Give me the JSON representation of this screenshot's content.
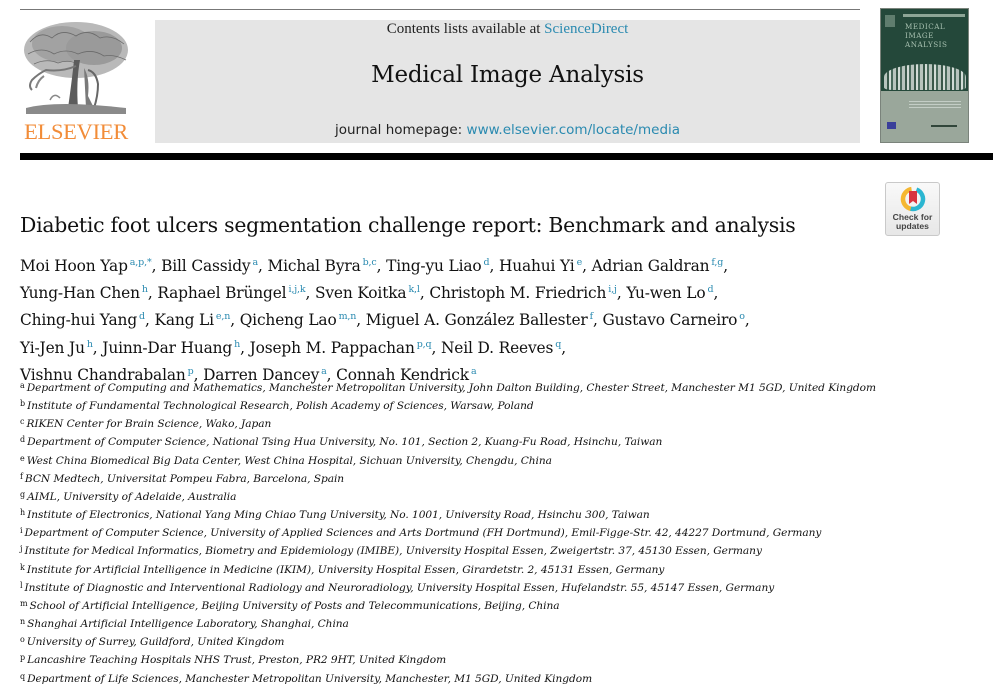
{
  "header": {
    "contents_prefix": "Contents lists available at ",
    "contents_link": "ScienceDirect",
    "journal_title": "Medical Image Analysis",
    "homepage_prefix": "journal homepage: ",
    "homepage_link": "www.elsevier.com/locate/media",
    "publisher": "ELSEVIER",
    "cover_title_lines": [
      "MEDICAL",
      "IMAGE",
      "ANALYSIS"
    ]
  },
  "check_updates": {
    "line1": "Check for",
    "line2": "updates"
  },
  "article": {
    "title": "Diabetic foot ulcers segmentation challenge report: Benchmark and analysis"
  },
  "authors": {
    "lines": [
      [
        {
          "name": "Moi Hoon Yap",
          "refs": "a,p,*",
          "sep": ", "
        },
        {
          "name": "Bill Cassidy",
          "refs": "a",
          "sep": ", "
        },
        {
          "name": "Michal Byra",
          "refs": "b,c",
          "sep": ", "
        },
        {
          "name": "Ting-yu Liao",
          "refs": "d",
          "sep": ", "
        },
        {
          "name": "Huahui Yi",
          "refs": "e",
          "sep": ", "
        },
        {
          "name": "Adrian Galdran",
          "refs": "f,g",
          "sep": ","
        }
      ],
      [
        {
          "name": "Yung-Han Chen",
          "refs": "h",
          "sep": ", "
        },
        {
          "name": "Raphael Brüngel",
          "refs": "i,j,k",
          "sep": ", "
        },
        {
          "name": "Sven Koitka",
          "refs": "k,l",
          "sep": ", "
        },
        {
          "name": "Christoph M. Friedrich",
          "refs": "i,j",
          "sep": ", "
        },
        {
          "name": "Yu-wen Lo",
          "refs": "d",
          "sep": ","
        }
      ],
      [
        {
          "name": "Ching-hui Yang",
          "refs": "d",
          "sep": ", "
        },
        {
          "name": "Kang Li",
          "refs": "e,n",
          "sep": ", "
        },
        {
          "name": "Qicheng Lao",
          "refs": "m,n",
          "sep": ", "
        },
        {
          "name": "Miguel A. González Ballester",
          "refs": "f",
          "sep": ", "
        },
        {
          "name": "Gustavo Carneiro",
          "refs": "o",
          "sep": ","
        }
      ],
      [
        {
          "name": "Yi-Jen Ju",
          "refs": "h",
          "sep": ", "
        },
        {
          "name": "Juinn-Dar Huang",
          "refs": "h",
          "sep": ", "
        },
        {
          "name": "Joseph M. Pappachan",
          "refs": "p,q",
          "sep": ", "
        },
        {
          "name": "Neil D. Reeves",
          "refs": "q",
          "sep": ","
        }
      ],
      [
        {
          "name": "Vishnu Chandrabalan",
          "refs": "p",
          "sep": ", "
        },
        {
          "name": "Darren Dancey",
          "refs": "a",
          "sep": ", "
        },
        {
          "name": "Connah Kendrick",
          "refs": "a",
          "sep": ""
        }
      ]
    ]
  },
  "affiliations": [
    {
      "label": "a",
      "text": "Department of Computing and Mathematics, Manchester Metropolitan University, John Dalton Building, Chester Street, Manchester M1 5GD, United Kingdom"
    },
    {
      "label": "b",
      "text": "Institute of Fundamental Technological Research, Polish Academy of Sciences, Warsaw, Poland"
    },
    {
      "label": "c",
      "text": "RIKEN Center for Brain Science, Wako, Japan"
    },
    {
      "label": "d",
      "text": "Department of Computer Science, National Tsing Hua University, No. 101, Section 2, Kuang-Fu Road, Hsinchu, Taiwan"
    },
    {
      "label": "e",
      "text": "West China Biomedical Big Data Center, West China Hospital, Sichuan University, Chengdu, China"
    },
    {
      "label": "f",
      "text": "BCN Medtech, Universitat Pompeu Fabra, Barcelona, Spain"
    },
    {
      "label": "g",
      "text": "AIML, University of Adelaide, Australia"
    },
    {
      "label": "h",
      "text": "Institute of Electronics, National Yang Ming Chiao Tung University, No. 1001, University Road, Hsinchu 300, Taiwan"
    },
    {
      "label": "i",
      "text": "Department of Computer Science, University of Applied Sciences and Arts Dortmund (FH Dortmund), Emil-Figge-Str. 42, 44227 Dortmund, Germany"
    },
    {
      "label": "j",
      "text": "Institute for Medical Informatics, Biometry and Epidemiology (IMIBE), University Hospital Essen, Zweigertstr. 37, 45130 Essen, Germany"
    },
    {
      "label": "k",
      "text": "Institute for Artificial Intelligence in Medicine (IKIM), University Hospital Essen, Girardetstr. 2, 45131 Essen, Germany"
    },
    {
      "label": "l",
      "text": "Institute of Diagnostic and Interventional Radiology and Neuroradiology, University Hospital Essen, Hufelandstr. 55, 45147 Essen, Germany"
    },
    {
      "label": "m",
      "text": "School of Artificial Intelligence, Beijing University of Posts and Telecommunications, Beijing, China"
    },
    {
      "label": "n",
      "text": "Shanghai Artificial Intelligence Laboratory, Shanghai, China"
    },
    {
      "label": "o",
      "text": "University of Surrey, Guildford, United Kingdom"
    },
    {
      "label": "p",
      "text": "Lancashire Teaching Hospitals NHS Trust, Preston, PR2 9HT, United Kingdom"
    },
    {
      "label": "q",
      "text": "Department of Life Sciences, Manchester Metropolitan University, Manchester, M1 5GD, United Kingdom"
    }
  ],
  "colors": {
    "link": "#2a8ab0",
    "publisher_orange": "#f28c38",
    "banner_bg": "#e5e5e5",
    "cover_green": "#24483a"
  }
}
